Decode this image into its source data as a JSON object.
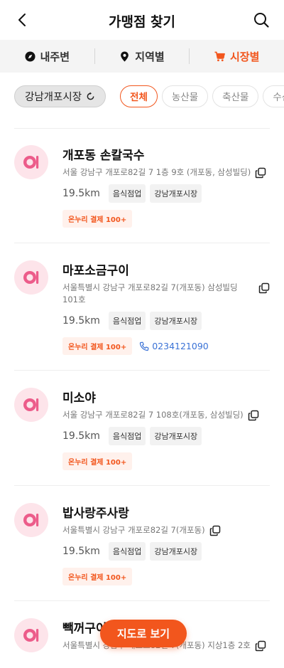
{
  "header": {
    "title": "가맹점 찾기"
  },
  "tabs": [
    {
      "label": "내주변",
      "icon": "compass-icon",
      "active": false
    },
    {
      "label": "지역별",
      "icon": "location-pin-icon",
      "active": false
    },
    {
      "label": "시장별",
      "icon": "cart-icon",
      "active": true
    }
  ],
  "filter": {
    "market": "강남개포시장",
    "categories": [
      "전체",
      "농산물",
      "축산물",
      "수산물"
    ],
    "active_category": "전체"
  },
  "stores": [
    {
      "name": "개포동 손칼국수",
      "address": "서울 강남구 개포로82길 7 1층 9호 (개포동, 삼성빌딩)",
      "distance": "19.5km",
      "category": "음식점업",
      "market": "강남개포시장",
      "badge": "온누리 결제 100+",
      "phone": ""
    },
    {
      "name": "마포소금구이",
      "address": "서울특별시 강남구 개포로82길 7(개포동) 삼성빌딩 101호",
      "distance": "19.5km",
      "category": "음식점업",
      "market": "강남개포시장",
      "badge": "온누리 결제 100+",
      "phone": "0234121090"
    },
    {
      "name": "미소야",
      "address": "서울 강남구 개포로82길 7 108호(개포동, 삼성빌딩)",
      "distance": "19.5km",
      "category": "음식점업",
      "market": "강남개포시장",
      "badge": "온누리 결제 100+",
      "phone": ""
    },
    {
      "name": "밥사랑주사랑",
      "address": "서울특별시 강남구 개포로82길 7(개포동)",
      "distance": "19.5km",
      "category": "음식점업",
      "market": "강남개포시장",
      "badge": "온누리 결제 100+",
      "phone": ""
    },
    {
      "name": "빽꺼구이촌",
      "address": "서울특별시 강남구 개포로82길 7(개포동) 지상1층 2호",
      "distance": "",
      "category": "",
      "market": "",
      "badge": "",
      "phone": ""
    }
  ],
  "map_button": "지도로 보기",
  "colors": {
    "accent": "#f2561d",
    "avatar_bg": "#fde4ea",
    "avatar_icon": "#ec5c8a",
    "phone": "#3a72d6"
  }
}
